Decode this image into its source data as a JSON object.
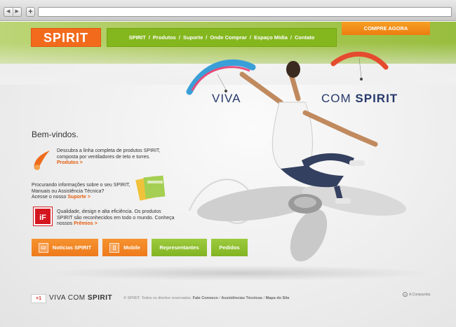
{
  "browser": {
    "back_icon": "back-icon",
    "forward_icon": "forward-icon",
    "add_tab": "+",
    "url": ""
  },
  "header": {
    "logo": "SPIRIT",
    "nav": [
      "SPIRIT",
      "Produtos",
      "Suporte",
      "Onde Comprar",
      "Espaço Mídia",
      "Contato"
    ],
    "separator": "/",
    "cta": "COMPRE AGORA"
  },
  "hero": {
    "slogan_left": "VIVA",
    "slogan_right_thin": "COM",
    "slogan_right_bold": "SPIRIT"
  },
  "main": {
    "welcome": "Bem-vindos.",
    "features": [
      {
        "text": "Descubra a linha completa de produtos SPIRIT, composta por ventiladores de teto e torres.",
        "link": "Produtos >"
      },
      {
        "text_line1": "Procurando informações sobre o seu SPIRIT,",
        "text_line2": "Manuais ou Assistência Técnica?",
        "text_line3": "Acesse o nosso",
        "link": "Suporte >"
      },
      {
        "text": "Qualidade, design e alta eficiência. Os produtos SPIRIT são reconhecidos em todo o mundo. Conheça nossos",
        "link": "Prêmios >",
        "icon_text": "iF"
      }
    ],
    "buttons": [
      "Notícias SPIRIT",
      "Mobile",
      "Representantes",
      "Pedidos"
    ]
  },
  "footer": {
    "gplus": "+1",
    "brand_thin": "VIVA COM",
    "brand_bold": "SPIRIT",
    "copyright": "© SPIRIT. Todos os direitos reservados.",
    "links": [
      "Fale Conosco",
      "Assistências Técnicas",
      "Mapa do Site"
    ],
    "agency": "A.Companhia"
  },
  "colors": {
    "orange": "#f26b1d",
    "green": "#84b71e",
    "navy": "#26396b"
  }
}
